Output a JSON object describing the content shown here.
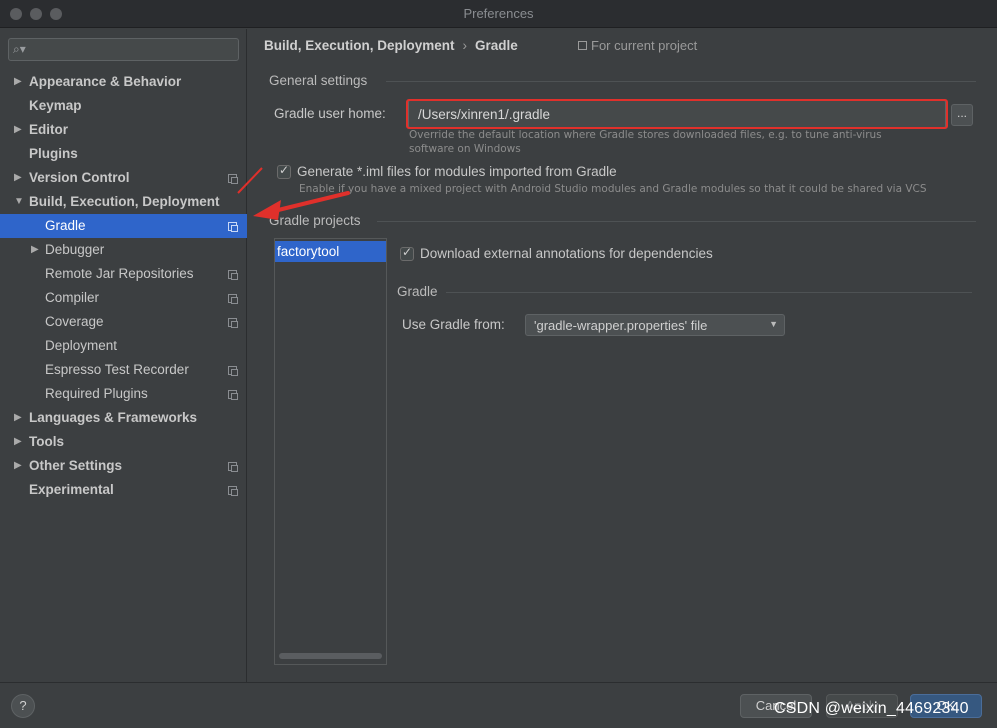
{
  "window": {
    "title": "Preferences"
  },
  "sidebar": {
    "search_placeholder": "",
    "items": [
      {
        "label": "Appearance & Behavior",
        "arrow": "▶",
        "project": false
      },
      {
        "label": "Keymap",
        "arrow": "",
        "project": false
      },
      {
        "label": "Editor",
        "arrow": "▶",
        "project": false
      },
      {
        "label": "Plugins",
        "arrow": "",
        "project": false
      },
      {
        "label": "Version Control",
        "arrow": "▶",
        "project": true
      },
      {
        "label": "Build, Execution, Deployment",
        "arrow": "▼",
        "project": false
      },
      {
        "label": "Gradle",
        "arrow": "",
        "project": true,
        "selected": true
      },
      {
        "label": "Debugger",
        "arrow": "▶",
        "project": false
      },
      {
        "label": "Remote Jar Repositories",
        "arrow": "",
        "project": true
      },
      {
        "label": "Compiler",
        "arrow": "",
        "project": true
      },
      {
        "label": "Coverage",
        "arrow": "",
        "project": true
      },
      {
        "label": "Deployment",
        "arrow": "",
        "project": false
      },
      {
        "label": "Espresso Test Recorder",
        "arrow": "",
        "project": true
      },
      {
        "label": "Required Plugins",
        "arrow": "",
        "project": true
      },
      {
        "label": "Languages & Frameworks",
        "arrow": "▶",
        "project": false
      },
      {
        "label": "Tools",
        "arrow": "▶",
        "project": false
      },
      {
        "label": "Other Settings",
        "arrow": "▶",
        "project": true
      },
      {
        "label": "Experimental",
        "arrow": "",
        "project": true
      }
    ]
  },
  "header": {
    "breadcrumb_parent": "Build, Execution, Deployment",
    "breadcrumb_sep": "›",
    "breadcrumb_current": "Gradle",
    "scope": "For current project"
  },
  "general": {
    "section_title": "General settings",
    "user_home_label": "Gradle user home:",
    "user_home_value": "/Users/xinren1/.gradle",
    "browse_label": "...",
    "user_home_hint_1": "Override the default location where Gradle stores downloaded files, e.g. to tune anti-virus",
    "user_home_hint_2": "software on Windows",
    "iml_label": "Generate *.iml files for modules imported from Gradle",
    "iml_hint": "Enable if you have a mixed project with Android Studio modules and Gradle modules so that it could be shared via VCS"
  },
  "projects": {
    "section_title": "Gradle projects",
    "items": [
      "factorytool"
    ],
    "download_annotations_label": "Download external annotations for dependencies",
    "gradle_section_title": "Gradle",
    "use_gradle_from_label": "Use Gradle from:",
    "use_gradle_from_value": "'gradle-wrapper.properties' file"
  },
  "footer": {
    "help_label": "?",
    "cancel_label": "Cancel",
    "apply_label": "Apply",
    "ok_label": "OK",
    "watermark": "CSDN @weixin_44692340"
  },
  "colors": {
    "accent": "#2f65ca",
    "highlight": "#e0302b",
    "background": "#3c3f41"
  }
}
